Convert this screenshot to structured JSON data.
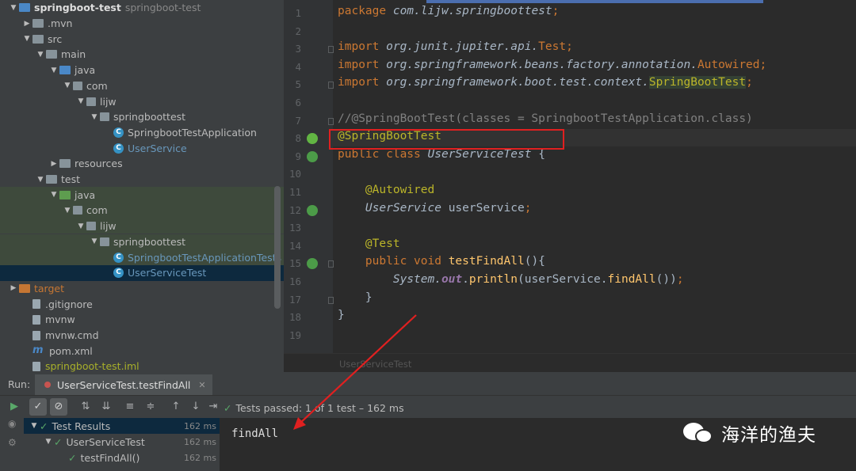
{
  "project_tree": [
    {
      "label": "springboot-test",
      "sublabel": "springboot-test",
      "depth": 0,
      "arrow": "▼",
      "icon": "module-folder",
      "style": "bold"
    },
    {
      "label": ".mvn",
      "depth": 1,
      "arrow": "▶",
      "icon": "folder"
    },
    {
      "label": "src",
      "depth": 1,
      "arrow": "▼",
      "icon": "folder"
    },
    {
      "label": "main",
      "depth": 2,
      "arrow": "▼",
      "icon": "folder"
    },
    {
      "label": "java",
      "depth": 3,
      "arrow": "▼",
      "icon": "folder-blue"
    },
    {
      "label": "com",
      "depth": 4,
      "arrow": "▼",
      "icon": "package"
    },
    {
      "label": "lijw",
      "depth": 5,
      "arrow": "▼",
      "icon": "package"
    },
    {
      "label": "springboottest",
      "depth": 6,
      "arrow": "▼",
      "icon": "package"
    },
    {
      "label": "SpringbootTestApplication",
      "depth": 7,
      "arrow": "",
      "icon": "spring-class"
    },
    {
      "label": "UserService",
      "depth": 7,
      "arrow": "",
      "icon": "class",
      "style": "class"
    },
    {
      "label": "resources",
      "depth": 3,
      "arrow": "▶",
      "icon": "folder"
    },
    {
      "label": "test",
      "depth": 2,
      "arrow": "▼",
      "icon": "folder"
    },
    {
      "label": "java",
      "depth": 3,
      "arrow": "▼",
      "icon": "folder-green",
      "row": "green"
    },
    {
      "label": "com",
      "depth": 4,
      "arrow": "▼",
      "icon": "package",
      "row": "green"
    },
    {
      "label": "lijw",
      "depth": 5,
      "arrow": "▼",
      "icon": "package",
      "row": "green"
    },
    {
      "label": "springboottest",
      "depth": 6,
      "arrow": "▼",
      "icon": "package",
      "row": "green"
    },
    {
      "label": "SpringbootTestApplicationTests",
      "depth": 7,
      "arrow": "",
      "icon": "class",
      "style": "class",
      "row": "green"
    },
    {
      "label": "UserServiceTest",
      "depth": 7,
      "arrow": "",
      "icon": "class",
      "style": "class",
      "row": "selected"
    },
    {
      "label": "target",
      "depth": 0,
      "arrow": "▶",
      "icon": "folder-orange",
      "style": "target"
    },
    {
      "label": ".gitignore",
      "depth": 1,
      "arrow": "",
      "icon": "file"
    },
    {
      "label": "mvnw",
      "depth": 1,
      "arrow": "",
      "icon": "file"
    },
    {
      "label": "mvnw.cmd",
      "depth": 1,
      "arrow": "",
      "icon": "file"
    },
    {
      "label": "pom.xml",
      "depth": 1,
      "arrow": "",
      "icon": "maven"
    },
    {
      "label": "springboot-test.iml",
      "depth": 1,
      "arrow": "",
      "icon": "file",
      "style": "iml"
    }
  ],
  "editor": {
    "line_numbers": [
      "1",
      "2",
      "3",
      "4",
      "5",
      "6",
      "7",
      "8",
      "9",
      "10",
      "11",
      "12",
      "13",
      "14",
      "15",
      "16",
      "17",
      "18",
      "19"
    ],
    "lines": [
      [
        {
          "t": "package ",
          "c": "kw"
        },
        {
          "t": "com.lijw.springboottest",
          "c": "pkg-name"
        },
        {
          "t": ";",
          "c": "kw"
        }
      ],
      [],
      [
        {
          "t": "import ",
          "c": "kw"
        },
        {
          "t": "org.junit.jupiter.api.",
          "c": "pkg-name"
        },
        {
          "t": "Test",
          "c": "kw"
        },
        {
          "t": ";",
          "c": "kw"
        }
      ],
      [
        {
          "t": "import ",
          "c": "kw"
        },
        {
          "t": "org.springframework.beans.factory.annotation.",
          "c": "pkg-name"
        },
        {
          "t": "Autowired",
          "c": "kw"
        },
        {
          "t": ";",
          "c": "kw"
        }
      ],
      [
        {
          "t": "import ",
          "c": "kw"
        },
        {
          "t": "org.springframework.boot.test.context.",
          "c": "pkg-name"
        },
        {
          "t": "SpringBootTest",
          "c": "ann-hl"
        },
        {
          "t": ";",
          "c": "kw"
        }
      ],
      [],
      [
        {
          "t": "/",
          "c": "comment"
        },
        {
          "t": "/@SpringBootTest(classes = SpringbootTestApplication.class)",
          "c": "comment"
        }
      ],
      [
        {
          "t": "@SpringBootTest",
          "c": "ann"
        }
      ],
      [
        {
          "t": "public class ",
          "c": "kw"
        },
        {
          "t": "UserServiceTest ",
          "c": "cls-it"
        },
        {
          "t": "{",
          "c": "ident"
        }
      ],
      [],
      [
        {
          "t": "    ",
          "c": "ident"
        },
        {
          "t": "@Autowired",
          "c": "ann"
        }
      ],
      [
        {
          "t": "    ",
          "c": "ident"
        },
        {
          "t": "UserService ",
          "c": "cls-it"
        },
        {
          "t": "userService",
          "c": "ident"
        },
        {
          "t": ";",
          "c": "kw"
        }
      ],
      [],
      [
        {
          "t": "    ",
          "c": "ident"
        },
        {
          "t": "@Test",
          "c": "ann"
        }
      ],
      [
        {
          "t": "    ",
          "c": "ident"
        },
        {
          "t": "public void ",
          "c": "kw"
        },
        {
          "t": "testFindAll",
          "c": "method"
        },
        {
          "t": "(){",
          "c": "ident"
        }
      ],
      [
        {
          "t": "        ",
          "c": "ident"
        },
        {
          "t": "System.",
          "c": "cls-it"
        },
        {
          "t": "out",
          "c": "out"
        },
        {
          "t": ".",
          "c": "ident"
        },
        {
          "t": "println",
          "c": "method"
        },
        {
          "t": "(userService.",
          "c": "ident"
        },
        {
          "t": "findAll",
          "c": "method"
        },
        {
          "t": "())",
          "c": "ident"
        },
        {
          "t": ";",
          "c": "kw"
        }
      ],
      [
        {
          "t": "    }",
          "c": "ident"
        }
      ],
      [
        {
          "t": "}",
          "c": "ident"
        }
      ],
      []
    ],
    "breadcrumb": "UserServiceTest"
  },
  "run_panel": {
    "run_label": "Run:",
    "tab_label": "UserServiceTest.testFindAll",
    "status": "Tests passed: 1 of 1 test – 162 ms",
    "results": [
      {
        "label": "Test Results",
        "time": "162 ms",
        "depth": 0,
        "arrow": "▼",
        "selected": true
      },
      {
        "label": "UserServiceTest",
        "time": "162 ms",
        "depth": 1,
        "arrow": "▼"
      },
      {
        "label": "testFindAll()",
        "time": "162 ms",
        "depth": 2,
        "arrow": ""
      }
    ],
    "console_output": "findAll"
  },
  "watermark": {
    "text": "海洋的渔夫"
  }
}
